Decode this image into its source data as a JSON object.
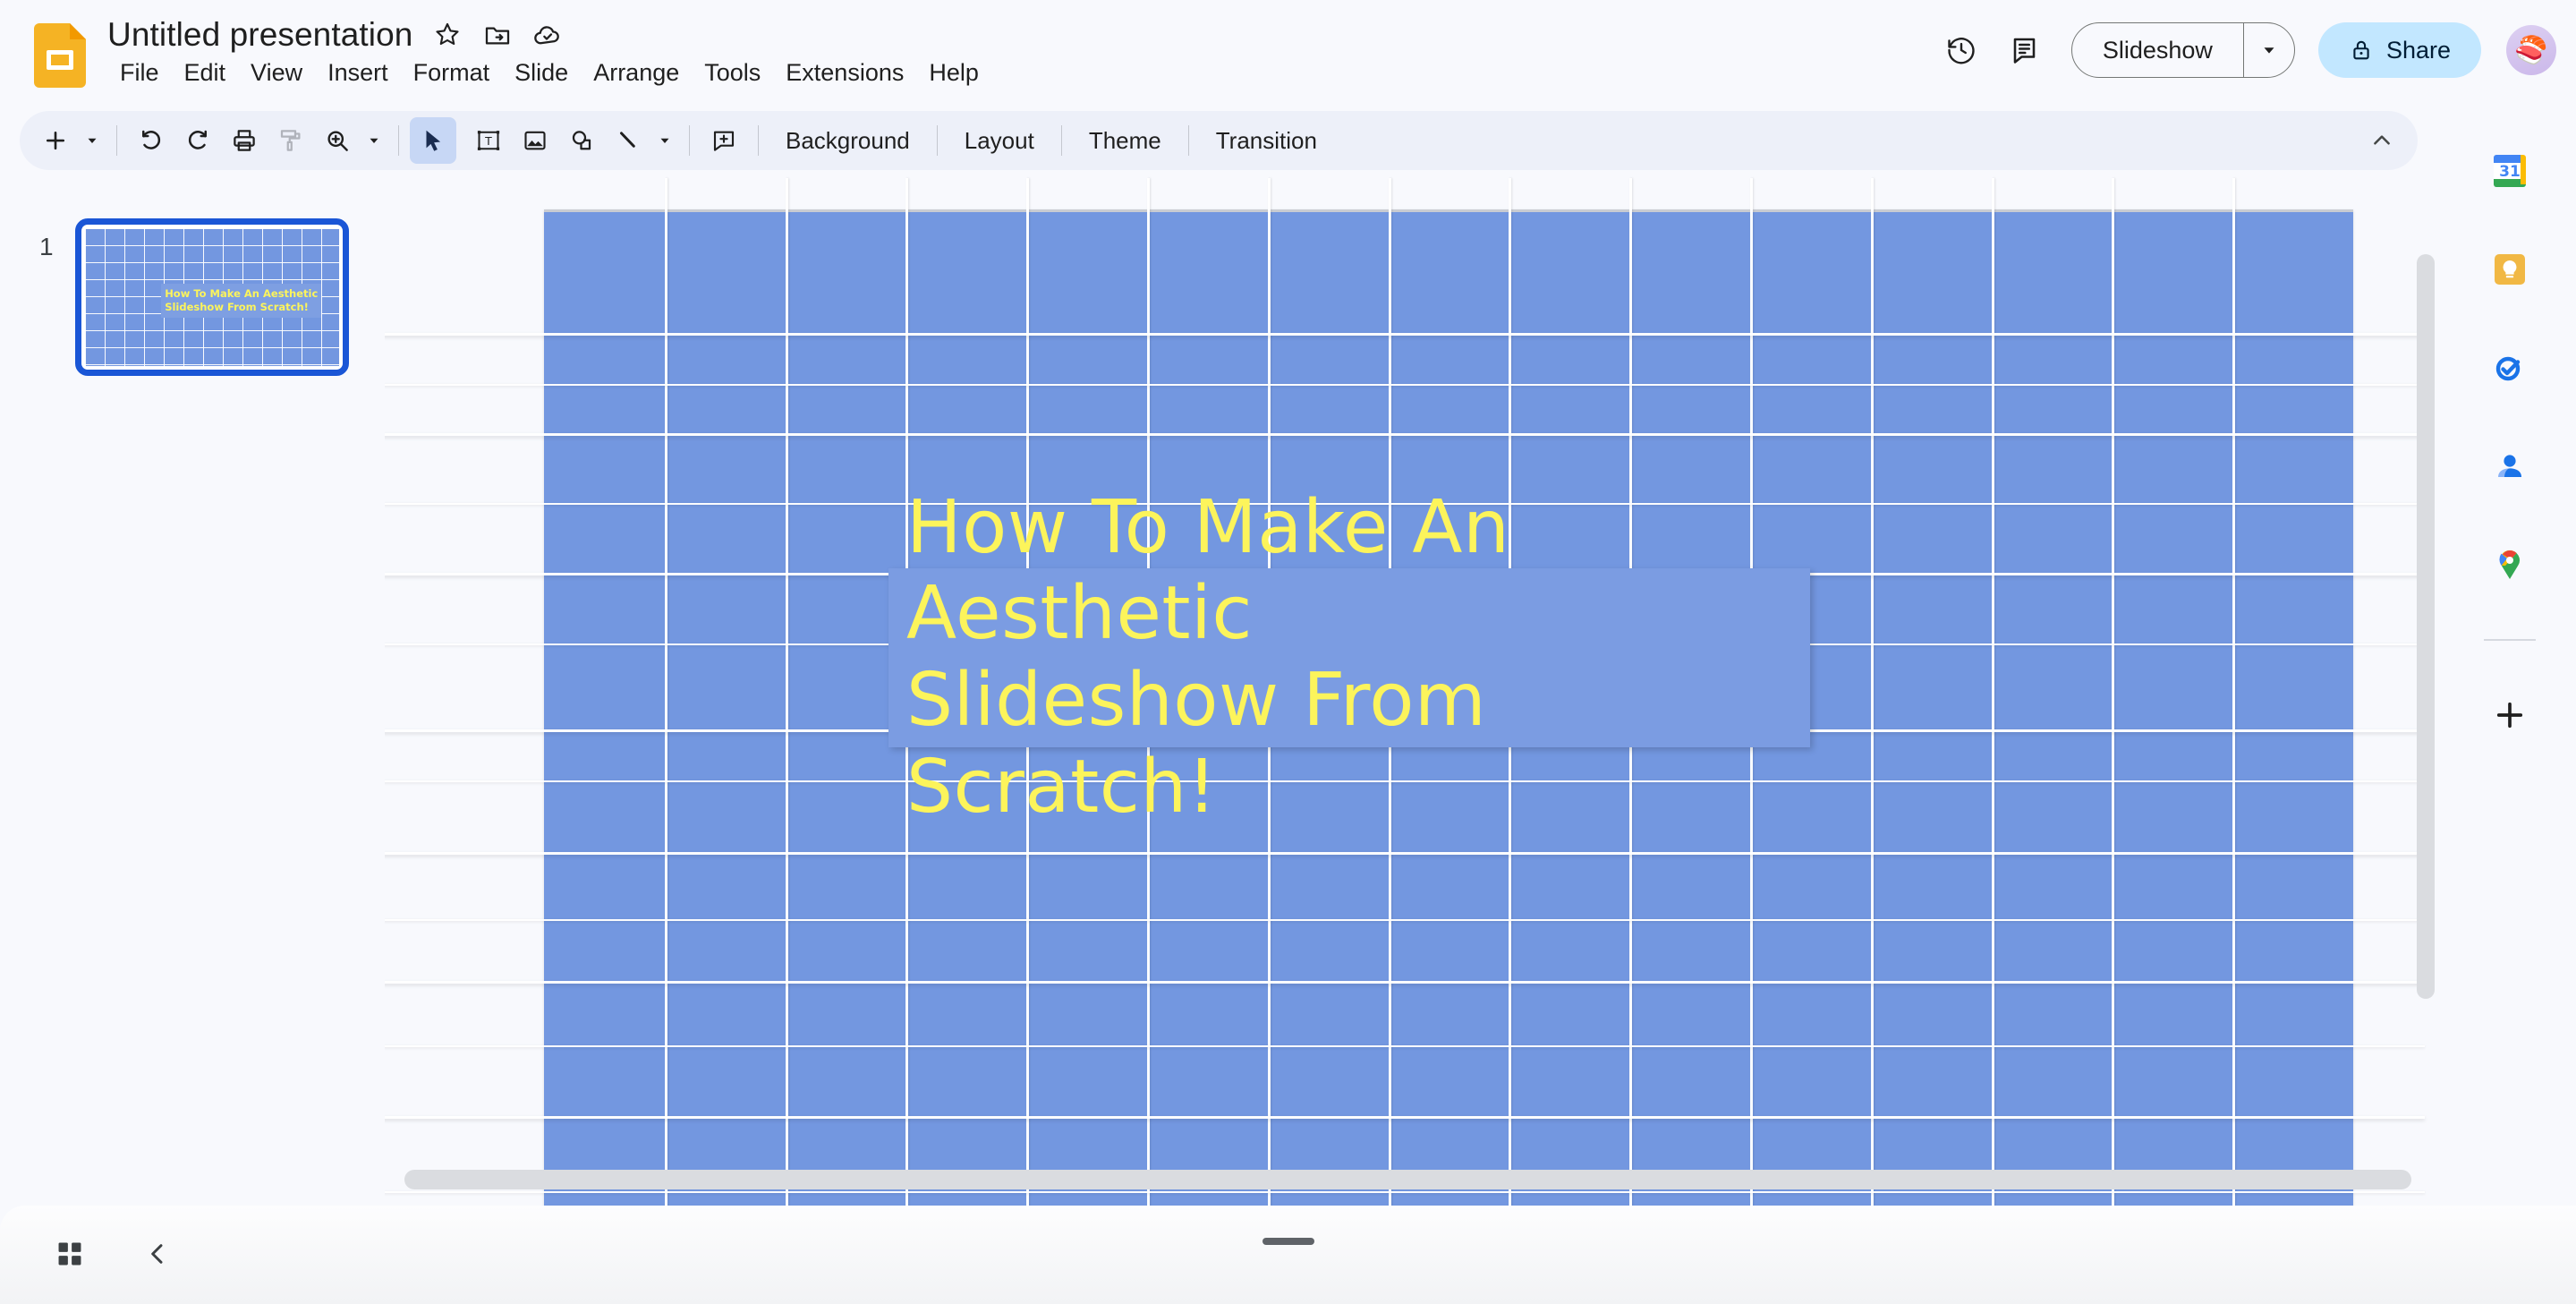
{
  "app": {
    "name": "Google Slides",
    "logo_icon": "slides-logo-icon"
  },
  "header": {
    "title": "Untitled presentation",
    "title_icons": [
      {
        "name": "star-icon",
        "glyph": "☆"
      },
      {
        "name": "move-to-folder-icon",
        "glyph": "folder"
      },
      {
        "name": "cloud-saved-icon",
        "glyph": "cloud"
      }
    ],
    "menu": [
      {
        "label": "File"
      },
      {
        "label": "Edit"
      },
      {
        "label": "View"
      },
      {
        "label": "Insert"
      },
      {
        "label": "Format"
      },
      {
        "label": "Slide"
      },
      {
        "label": "Arrange"
      },
      {
        "label": "Tools"
      },
      {
        "label": "Extensions"
      },
      {
        "label": "Help"
      }
    ],
    "right": {
      "history_icon": "version-history-icon",
      "comments_icon": "comment-history-icon",
      "slideshow_label": "Slideshow",
      "slideshow_caret_icon": "chevron-down-icon",
      "share_label": "Share",
      "share_lock_icon": "lock-icon",
      "avatar_icon": "user-avatar",
      "avatar_glyph": "🍣"
    }
  },
  "toolbar": {
    "buttons": [
      {
        "name": "new-slide-button",
        "icon": "plus-icon",
        "state": "enabled"
      },
      {
        "name": "new-slide-caret",
        "icon": "chevron-down-icon",
        "state": "enabled"
      },
      {
        "name": "undo-button",
        "icon": "undo-icon",
        "state": "enabled"
      },
      {
        "name": "redo-button",
        "icon": "redo-icon",
        "state": "enabled"
      },
      {
        "name": "print-button",
        "icon": "printer-icon",
        "state": "enabled"
      },
      {
        "name": "paint-format-button",
        "icon": "paint-roller-icon",
        "state": "disabled"
      },
      {
        "name": "zoom-button",
        "icon": "zoom-in-icon",
        "state": "enabled"
      },
      {
        "name": "zoom-caret",
        "icon": "chevron-down-icon",
        "state": "enabled"
      },
      {
        "name": "select-tool-button",
        "icon": "cursor-arrow-icon",
        "state": "active"
      },
      {
        "name": "text-box-button",
        "icon": "text-box-icon",
        "state": "enabled"
      },
      {
        "name": "insert-image-button",
        "icon": "image-icon",
        "state": "enabled"
      },
      {
        "name": "shape-button",
        "icon": "shape-icon",
        "state": "enabled"
      },
      {
        "name": "line-button",
        "icon": "line-icon",
        "state": "enabled"
      },
      {
        "name": "line-caret",
        "icon": "chevron-down-icon",
        "state": "enabled"
      },
      {
        "name": "add-comment-button",
        "icon": "add-comment-icon",
        "state": "enabled"
      }
    ],
    "text_buttons": [
      {
        "label": "Background"
      },
      {
        "label": "Layout"
      },
      {
        "label": "Theme"
      },
      {
        "label": "Transition"
      }
    ],
    "collapse_icon": "chevron-up-icon"
  },
  "filmstrip": {
    "slides": [
      {
        "number": "1",
        "selected": true,
        "title": "How To  Make An Aesthetic Slideshow From Scratch!"
      }
    ]
  },
  "canvas": {
    "slide": {
      "background_color": "#7397e0",
      "grid_line_color": "#ffffff",
      "title_box": {
        "text": "How To  Make An Aesthetic\nSlideshow From Scratch!",
        "text_color": "#fcf45b",
        "box_color": "#7b9ce2"
      }
    },
    "scrollbars": {
      "vertical": "vertical-scrollbar",
      "horizontal": "horizontal-scrollbar"
    }
  },
  "sidepanel": {
    "items": [
      {
        "name": "google-calendar-icon",
        "label": "Calendar",
        "badge": "31"
      },
      {
        "name": "google-keep-icon",
        "label": "Keep"
      },
      {
        "name": "google-tasks-icon",
        "label": "Tasks"
      },
      {
        "name": "google-contacts-icon",
        "label": "Contacts"
      },
      {
        "name": "google-maps-icon",
        "label": "Maps"
      },
      {
        "name": "add-addon-icon",
        "label": "Get add-ons"
      }
    ]
  },
  "bottombar": {
    "grid_view_icon": "grid-view-icon",
    "collapse_filmstrip_icon": "chevron-left-icon",
    "notes_handle": "speaker-notes-resize-handle"
  }
}
